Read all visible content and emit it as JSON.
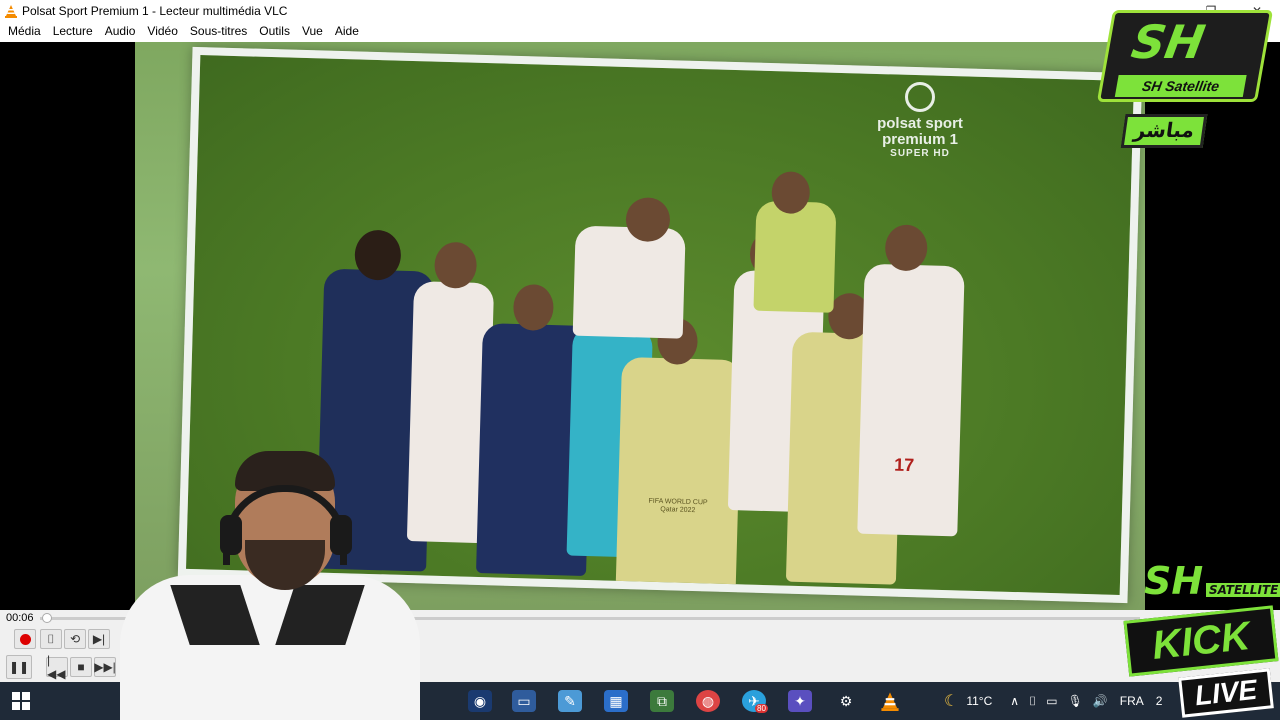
{
  "window": {
    "title": "Polsat Sport Premium 1 - Lecteur multimédia VLC",
    "minimize": "—",
    "maximize": "❐",
    "close": "✕"
  },
  "menu": [
    "Média",
    "Lecture",
    "Audio",
    "Vidéo",
    "Sous-titres",
    "Outils",
    "Vue",
    "Aide"
  ],
  "video": {
    "channel_line1": "polsat sport",
    "channel_line2": "premium 1",
    "channel_line3": "SUPER HD",
    "jersey_number": "17",
    "bib_text": "FIFA WORLD CUP Qatar 2022"
  },
  "overlay": {
    "sh_big": "SH",
    "sh_small": "SH Satellite",
    "live_arabic": "مباشر",
    "kick_sh": "SH",
    "kick_satellite": "SATELLITE",
    "kick": "KICK",
    "live": "LIVE"
  },
  "player": {
    "elapsed": "00:06",
    "progress_fraction": 0.005
  },
  "taskbar": {
    "weather": "11°C",
    "language": "FRA",
    "clock_partial": "2",
    "badge_count": "80"
  },
  "icons": [
    "vlc-cone-icon",
    "record-icon",
    "snapshot-icon",
    "loop-icon",
    "frame-step-icon",
    "playlist-icon",
    "pause-icon",
    "previous-icon",
    "stop-icon",
    "next-icon",
    "windows-start-icon",
    "moon-icon",
    "chevron-up-icon",
    "usb-icon",
    "network-icon",
    "microphone-icon",
    "volume-icon"
  ]
}
